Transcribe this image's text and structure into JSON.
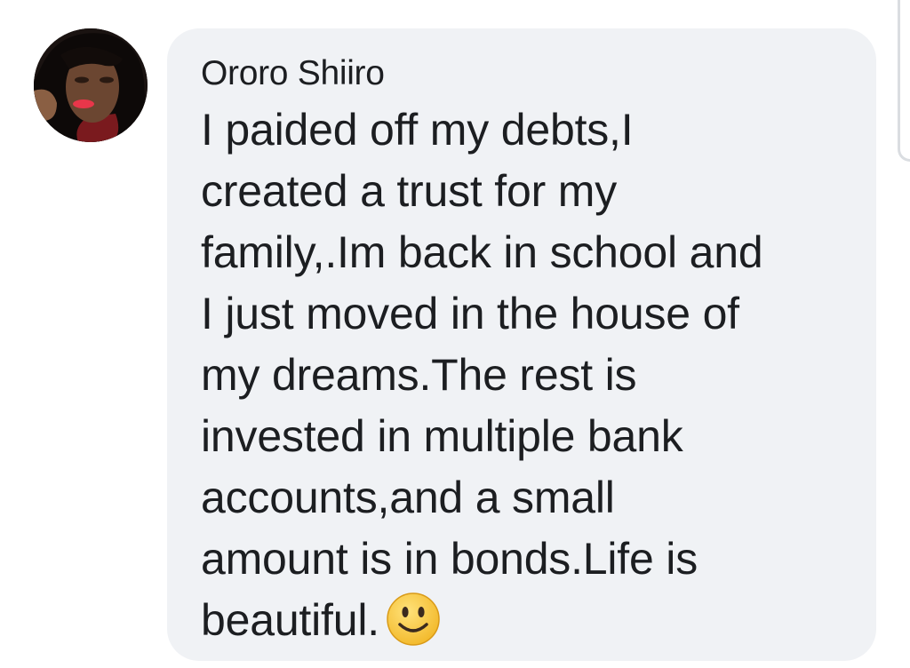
{
  "comment": {
    "author": "Ororo Shiiro",
    "text_lines": [
      "I paided off my debts,I",
      "created a trust for my",
      "family,.Im back in school and",
      "I just moved in the house of",
      "my dreams.The rest is",
      "invested in multiple bank",
      "accounts,and a small",
      "amount is in bonds.Life is",
      "beautiful."
    ],
    "emoji": "slightly-smiling-face-icon"
  },
  "colors": {
    "bubble_background": "#f0f2f5",
    "text": "#1c1e21",
    "emoji_face": "#f7c83a"
  }
}
